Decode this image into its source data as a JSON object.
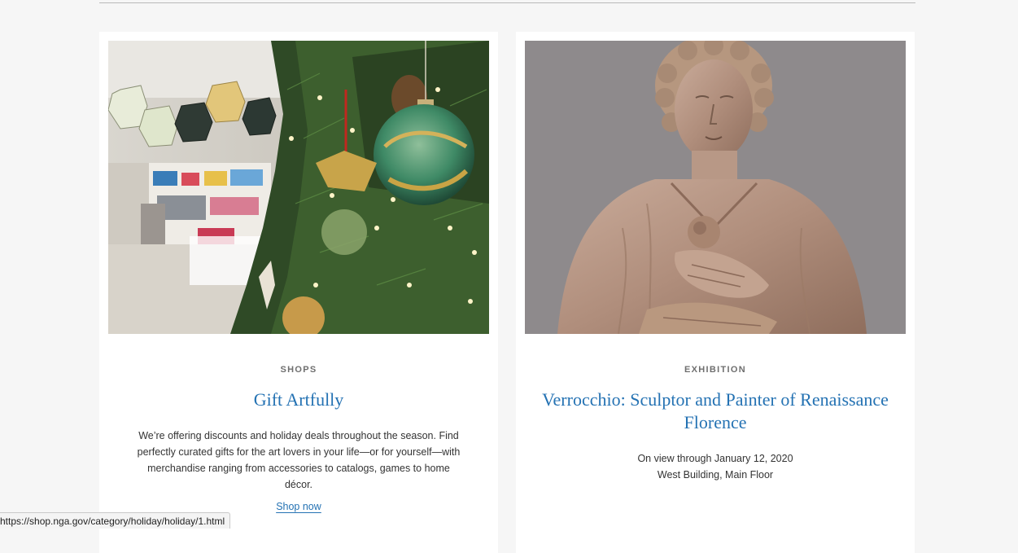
{
  "cards": [
    {
      "image_alt": "Christmas tree with ornaments in museum shop",
      "category": "SHOPS",
      "title": "Gift Artfully",
      "description": "We’re offering discounts and holiday deals throughout the season. Find perfectly curated gifts for the art lovers in your life—or for yourself—with merchandise ranging from accessories to catalogs, games to home décor.",
      "cta_label": "Shop now"
    },
    {
      "image_alt": "Marble bust of a woman holding flowers",
      "category": "EXHIBITION",
      "title": "Verrocchio: Sculptor and Painter of Renaissance Florence",
      "dates": "On view through January 12, 2020",
      "location": "West Building, Main Floor"
    }
  ],
  "status_bar": {
    "url": "https://shop.nga.gov/category/holiday/holiday/1.html"
  },
  "colors": {
    "link": "#2472b3",
    "page_bg": "#f6f6f6",
    "card_bg": "#ffffff",
    "eyebrow": "#6f6f6f"
  }
}
